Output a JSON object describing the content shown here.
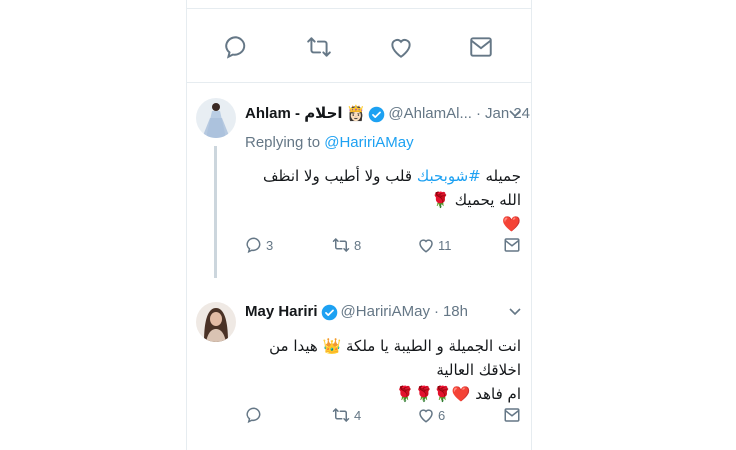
{
  "top_actions": [
    "reply-icon",
    "retweet-icon",
    "like-icon",
    "message-icon"
  ],
  "tweets": [
    {
      "display_name": "Ahlam - احلام 👸🏻",
      "handle": "@AhlamAl...",
      "time": "Jan 24",
      "replying_label": "Replying to",
      "replying_handle": "@HaririAMay",
      "text_prefix": "جميله ",
      "hashtag": "#شوبحبك",
      "text_suffix": " قلب ولا أطيب ولا انظف الله يحميك 🌹",
      "text_line2": "❤️",
      "replies": "3",
      "retweets": "8",
      "likes": "11"
    },
    {
      "display_name": "May Hariri",
      "handle": "@HaririAMay",
      "time": "18h",
      "text_line1": "انت الجميلة و الطيبة يا ملكة 👑 هيدا من اخلاقك العالية",
      "text_line2": "ام فاهد ❤️🌹🌹🌹",
      "replies": "",
      "retweets": "4",
      "likes": "6"
    }
  ],
  "colors": {
    "accent": "#1da1f2",
    "muted": "#657786",
    "icon": "#657786",
    "border": "#e6ecf0"
  }
}
